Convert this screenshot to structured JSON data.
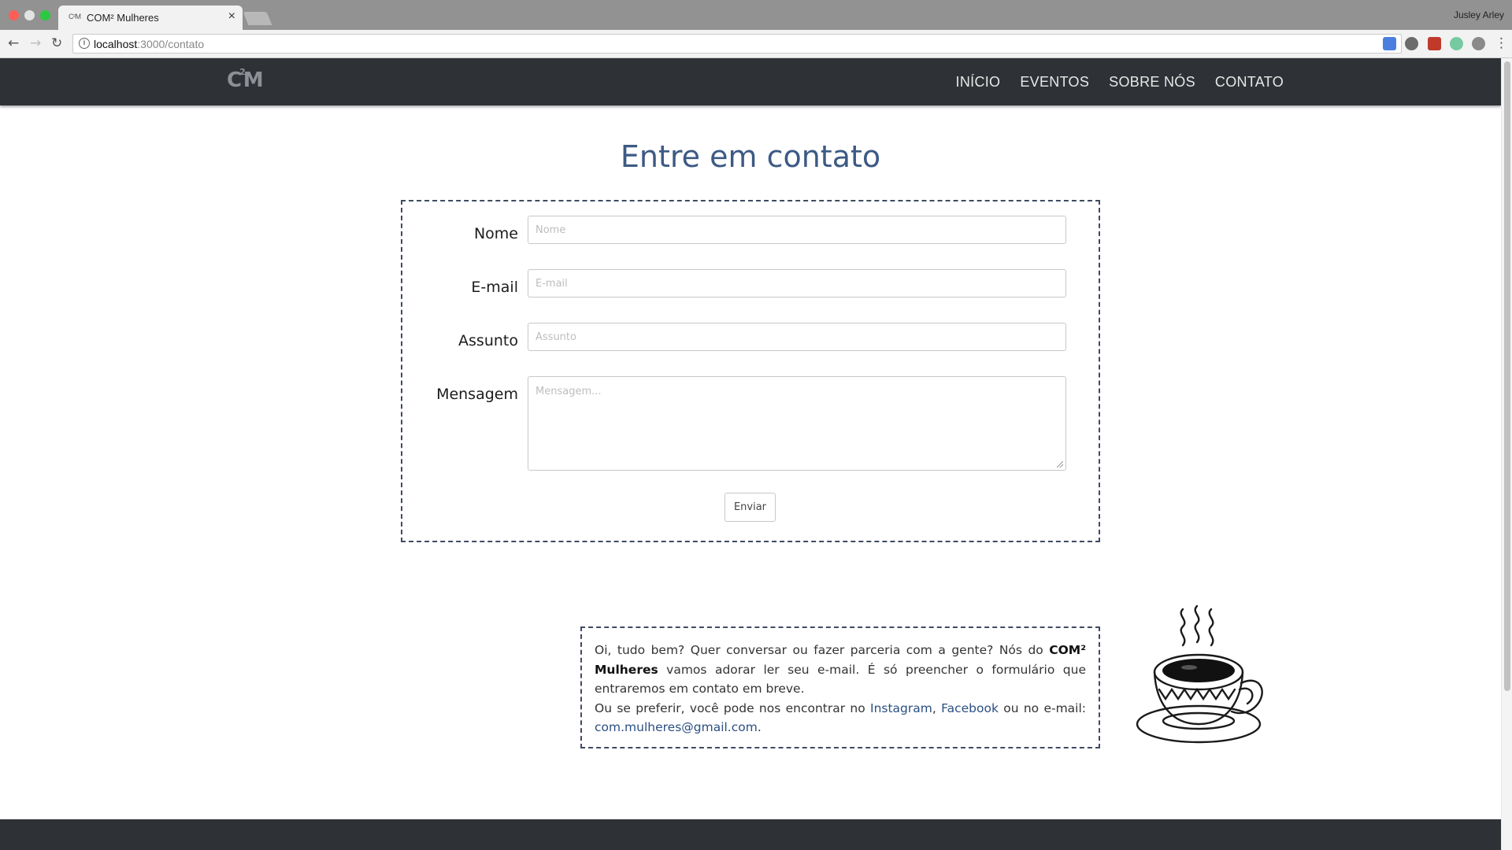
{
  "browser": {
    "tab_title": "COM² Mulheres",
    "tab_favicon": "C²M",
    "tab_close": "×",
    "profile_name": "Jusley Arley",
    "url_host": "localhost",
    "url_path": ":3000/contato",
    "back_icon": "←",
    "forward_icon": "→",
    "reload_icon": "↻",
    "info_icon": "i",
    "star_icon": "☆",
    "menu_icon": "⋮"
  },
  "navbar": {
    "brand_left": "C",
    "brand_sup": "2",
    "brand_right": "M",
    "links": [
      "INÍCIO",
      "EVENTOS",
      "SOBRE NÓS",
      "CONTATO"
    ]
  },
  "page": {
    "heading": "Entre em contato"
  },
  "form": {
    "name_label": "Nome",
    "name_placeholder": "Nome",
    "email_label": "E-mail",
    "email_placeholder": "E-mail",
    "subject_label": "Assunto",
    "subject_placeholder": "Assunto",
    "message_label": "Mensagem",
    "message_placeholder": "Mensagem...",
    "submit_label": "Enviar"
  },
  "info": {
    "text_1": "Oi, tudo bem? Quer conversar ou fazer parceria com a gente? Nós do ",
    "brand": "COM² Mulheres",
    "text_2": " vamos adorar ler seu e-mail. É só preencher o formulário que entraremos em contato em breve.",
    "text_3": "Ou se preferir, você pode nos encontrar no ",
    "instagram": "Instagram",
    "sep": ", ",
    "facebook": "Facebook",
    "text_4": " ou no e-mail: ",
    "email": "com.mulheres@gmail.com",
    "end": "."
  },
  "colors": {
    "navbar_bg": "#2e3236",
    "heading": "#3d5a84",
    "link": "#2b4f82",
    "dashed_border": "#3e4b62"
  }
}
